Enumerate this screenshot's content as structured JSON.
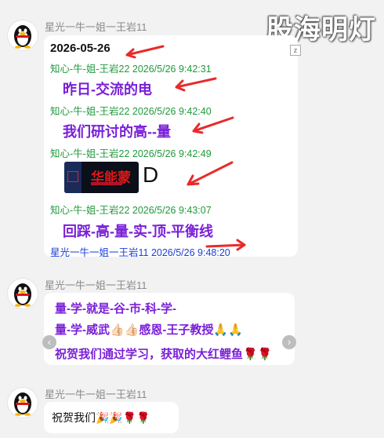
{
  "watermark": "股海明灯",
  "messages": [
    {
      "sender": "星光一牛一姐一王岩11",
      "date": "2026-05-26",
      "lines": [
        {
          "meta": "知心-牛-姐-王岩22 2026/5/26 9:42:31",
          "text": "昨日-交流的电"
        },
        {
          "meta": "知心-牛-姐-王岩22 2026/5/26 9:42:40",
          "text": "我们研讨的高--量"
        },
        {
          "meta": "知心-牛-姐-王岩22 2026/5/26 9:42:49",
          "image_text": "华能蒙",
          "suffix": "D"
        },
        {
          "meta": "知心-牛-姐-王岩22 2026/5/26 9:43:07",
          "text": "回踩-高-量-实-顶-平衡线"
        }
      ],
      "footer": "星光一牛一姐一王岩11 2026/5/26 9:48:20",
      "corner_icon": "z"
    },
    {
      "sender": "星光一牛一姐一王岩11",
      "lines": [
        "量-学-就是-谷-市-科-学-",
        "量-学-威武👍🏻👍🏻感恩-王子教授🙏🙏",
        "祝贺我们通过学习，获取的大红鲤鱼🌹🌹"
      ],
      "prev": "‹",
      "next": "›"
    },
    {
      "sender": "星光一牛一姐一王岩11",
      "text": "祝贺我们🎉🎉🌹🌹"
    }
  ],
  "colors": {
    "purple": "#7a1fd8",
    "green": "#1f9a3c",
    "blue": "#1b3fd6",
    "arrow": "#e82a2a"
  },
  "icons": [
    "qq-penguin-avatar-icon",
    "red-arrow-icon",
    "chevron-left-icon",
    "chevron-right-icon"
  ]
}
